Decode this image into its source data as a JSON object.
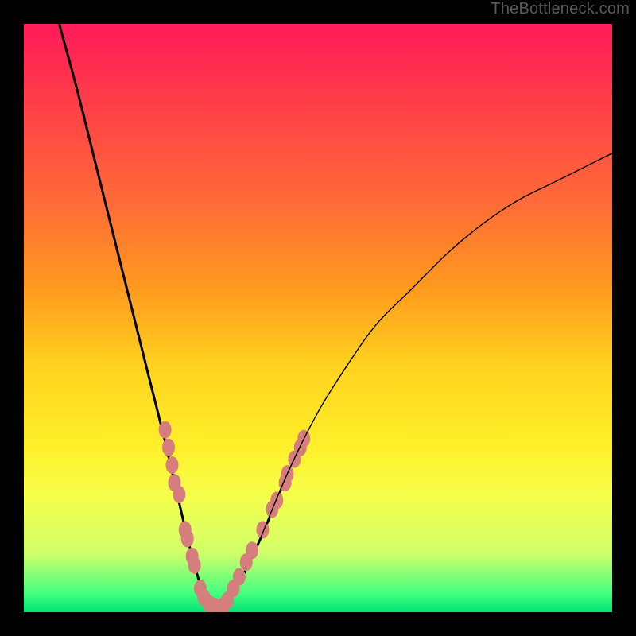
{
  "watermark": "TheBottleneck.com",
  "colors": {
    "background_border": "#000000",
    "curve_stroke": "#000000",
    "marker_fill": "#d67d7d",
    "gradient_top": "#ff1a58",
    "gradient_bottom": "#00e476"
  },
  "chart_data": {
    "type": "line",
    "title": "",
    "xlabel": "",
    "ylabel": "",
    "xlim": [
      0,
      100
    ],
    "ylim": [
      0,
      100
    ],
    "grid": false,
    "annotations": [
      "TheBottleneck.com"
    ],
    "series": [
      {
        "name": "bottleneck-curve",
        "x": [
          6,
          9,
          12,
          15,
          18,
          21,
          24,
          27,
          29,
          31,
          33,
          35,
          40,
          45,
          50,
          55,
          60,
          66,
          72,
          78,
          84,
          90,
          96,
          100
        ],
        "y": [
          100,
          89,
          77,
          65,
          53,
          41,
          29,
          16,
          8,
          2,
          0,
          2,
          12,
          24,
          34,
          42,
          49,
          55,
          61,
          66,
          70,
          73,
          76,
          78
        ]
      }
    ],
    "markers": [
      {
        "x": 24.0,
        "y": 31
      },
      {
        "x": 24.6,
        "y": 28
      },
      {
        "x": 25.2,
        "y": 25
      },
      {
        "x": 25.6,
        "y": 22
      },
      {
        "x": 26.4,
        "y": 20
      },
      {
        "x": 27.4,
        "y": 14
      },
      {
        "x": 27.8,
        "y": 12.5
      },
      {
        "x": 28.6,
        "y": 9.5
      },
      {
        "x": 29.0,
        "y": 8
      },
      {
        "x": 30.0,
        "y": 4
      },
      {
        "x": 30.6,
        "y": 2.5
      },
      {
        "x": 31.4,
        "y": 1.5
      },
      {
        "x": 32.4,
        "y": 1
      },
      {
        "x": 33.0,
        "y": 0.5
      },
      {
        "x": 33.8,
        "y": 1
      },
      {
        "x": 34.6,
        "y": 2
      },
      {
        "x": 35.6,
        "y": 4
      },
      {
        "x": 36.6,
        "y": 6
      },
      {
        "x": 37.8,
        "y": 8.5
      },
      {
        "x": 38.8,
        "y": 10.5
      },
      {
        "x": 40.6,
        "y": 14
      },
      {
        "x": 42.2,
        "y": 17.5
      },
      {
        "x": 43.0,
        "y": 19
      },
      {
        "x": 44.4,
        "y": 22
      },
      {
        "x": 44.8,
        "y": 23.5
      },
      {
        "x": 46.0,
        "y": 26
      },
      {
        "x": 47.0,
        "y": 28
      },
      {
        "x": 47.6,
        "y": 29.5
      }
    ]
  }
}
